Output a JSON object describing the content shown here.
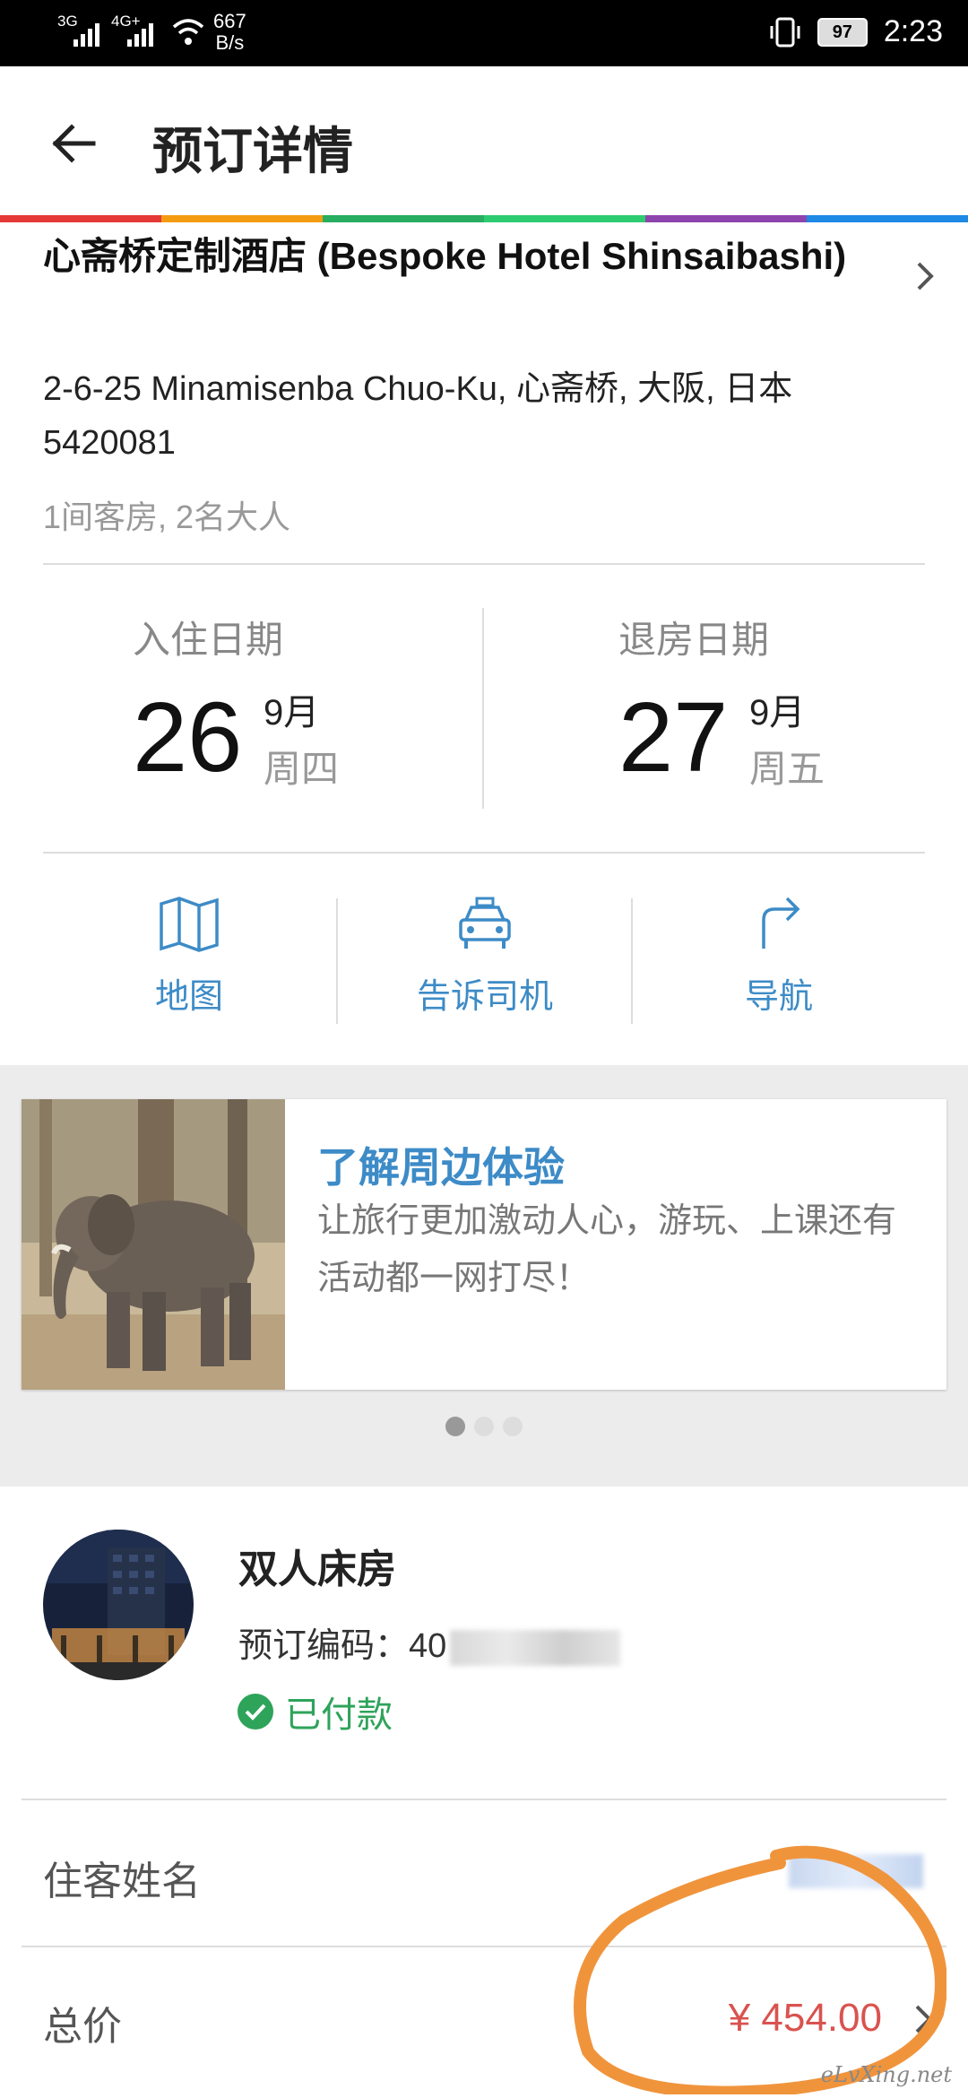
{
  "status_bar": {
    "signal1": "3G",
    "signal2": "4G+",
    "net_speed_value": "667",
    "net_speed_unit": "B/s",
    "battery": "97",
    "time": "2:23"
  },
  "header": {
    "title": "预订详情"
  },
  "hotel": {
    "name": "心斋桥定制酒店 (Bespoke Hotel Shinsaibashi)",
    "address": "2-6-25 Minamisenba Chuo-Ku, 心斋桥, 大阪, 日本 5420081",
    "rooms_guests": "1间客房, 2名大人"
  },
  "checkin": {
    "label": "入住日期",
    "day": "26",
    "month": "9月",
    "weekday": "周四"
  },
  "checkout": {
    "label": "退房日期",
    "day": "27",
    "month": "9月",
    "weekday": "周五"
  },
  "actions": [
    {
      "label": "地图",
      "icon": "map-icon"
    },
    {
      "label": "告诉司机",
      "icon": "taxi-icon"
    },
    {
      "label": "导航",
      "icon": "turn-right-arrow-icon"
    }
  ],
  "promo": {
    "title": "了解周边体验",
    "description": "让旅行更加激动人心，游玩、上课还有活动都一网打尽！",
    "page_count": 3,
    "active_page": 1
  },
  "booking": {
    "room_type": "双人床房",
    "code_label": "预订编码：",
    "code_visible": "40",
    "status": "已付款"
  },
  "guest": {
    "label": "住客姓名"
  },
  "total": {
    "label": "总价",
    "price": "¥ 454.00"
  },
  "watermark": "eLvXing.net",
  "colors": {
    "accent": "#3d8bc7",
    "paid": "#2ea35a",
    "price": "#d9534f",
    "annotation": "#f0943c",
    "rainbow": [
      "#e53935",
      "#f39c12",
      "#27ae60",
      "#2ecc71",
      "#8e44ad",
      "#1e88e5"
    ]
  }
}
